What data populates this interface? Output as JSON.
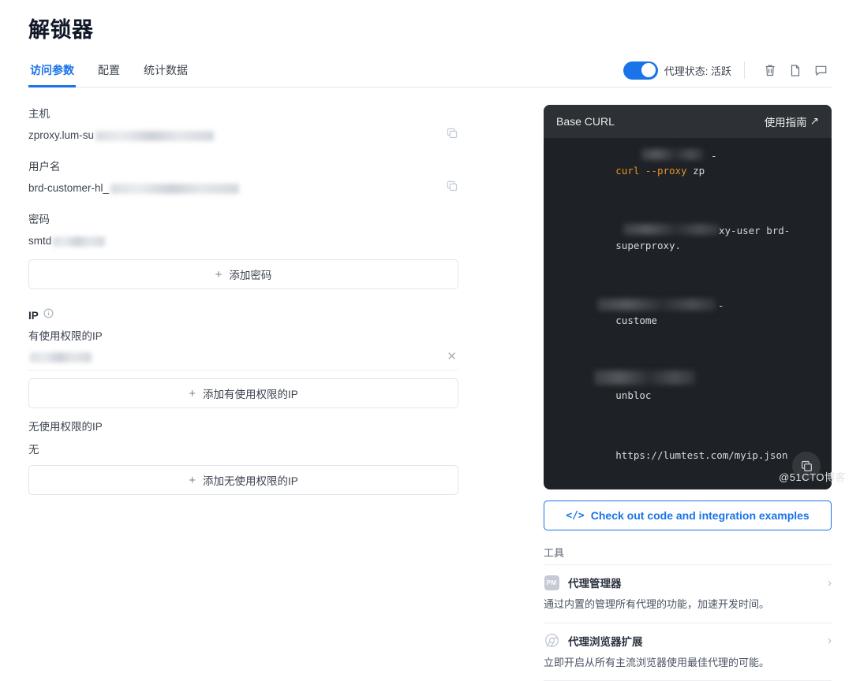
{
  "header": {
    "title": "解锁器",
    "tabs": [
      {
        "label": "访问参数",
        "active": true
      },
      {
        "label": "配置",
        "active": false
      },
      {
        "label": "统计数据",
        "active": false
      }
    ],
    "toggle": {
      "label": "代理状态: 活跃",
      "on": true,
      "color": "#1a73e8"
    },
    "actions": [
      {
        "name": "delete-icon",
        "title": "删除"
      },
      {
        "name": "duplicate-icon",
        "title": "复制"
      },
      {
        "name": "comment-icon",
        "title": "备注"
      }
    ]
  },
  "form": {
    "host": {
      "label": "主机",
      "value": "zproxy.lum-su",
      "masked": true
    },
    "username": {
      "label": "用户名",
      "value": "brd-customer-hl_",
      "masked": true
    },
    "password": {
      "label": "密码",
      "value": "smtd",
      "masked": true
    },
    "add_password_button": "添加密码",
    "ip": {
      "label": "IP",
      "allowed_label": "有使用权限的IP",
      "allowed_value": "",
      "add_allowed_button": "添加有使用权限的IP",
      "denied_label": "无使用权限的IP",
      "denied_value": "无",
      "add_denied_button": "添加无使用权限的IP"
    }
  },
  "code_panel": {
    "title": "Base CURL",
    "guide_link": "使用指南",
    "guide_arrow": "↗",
    "lines": [
      {
        "kw": "curl --proxy",
        "rest": " zp"
      },
      {
        "kw": "",
        "rest": "superproxy."
      },
      {
        "kw": "",
        "rest": "custome"
      },
      {
        "kw": "",
        "rest": "unbloc"
      },
      {
        "kw": "",
        "rest": "https://lumtest.com/myip.json"
      }
    ],
    "partial_tail_2": "xy-user brd-",
    "copy_button_name": "copy-code-button"
  },
  "examples_button": {
    "label": "Check out code and integration examples",
    "glyph": "</>"
  },
  "tools": {
    "title": "工具",
    "items": [
      {
        "icon": "proxy-manager-icon",
        "icon_text": "PM",
        "name": "代理管理器",
        "desc": "通过内置的管理所有代理的功能，加速开发时间。"
      },
      {
        "icon": "browser-extension-icon",
        "icon_text": "",
        "name": "代理浏览器扩展",
        "desc": "立即开启从所有主流浏览器使用最佳代理的可能。"
      }
    ]
  },
  "watermark": "@51CTO博客"
}
